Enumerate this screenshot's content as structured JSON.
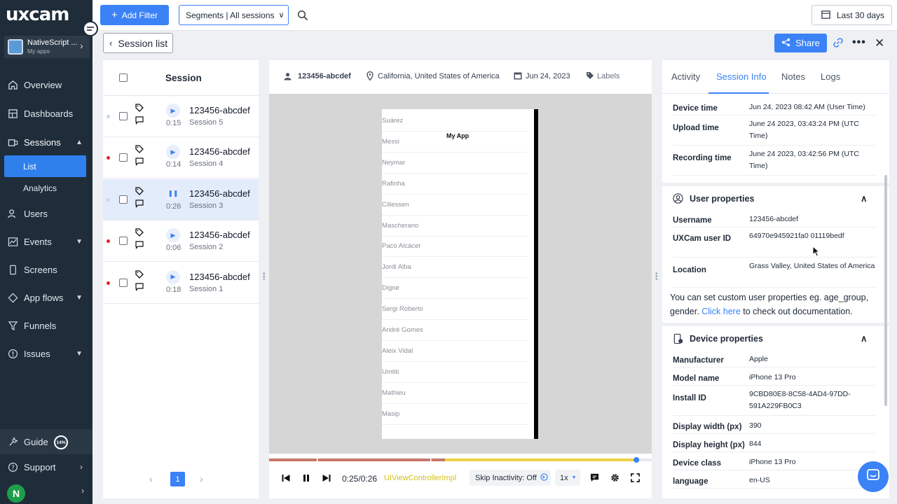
{
  "brand": {
    "logo": "uxcam"
  },
  "app_selector": {
    "name": "NativeScript ...",
    "subtitle": "My apps"
  },
  "nav": {
    "overview": "Overview",
    "dashboards": "Dashboards",
    "sessions": "Sessions",
    "list": "List",
    "analytics": "Analytics",
    "users": "Users",
    "events": "Events",
    "screens": "Screens",
    "app_flows": "App flows",
    "funnels": "Funnels",
    "issues": "Issues",
    "guide": "Guide",
    "guide_progress": "14%",
    "support": "Support",
    "avatar_initial": "N"
  },
  "topbar": {
    "add_filter": "Add Filter",
    "segments": "Segments | All sessions",
    "date_range": "Last 30 days"
  },
  "header": {
    "back_label": "Session list",
    "share_label": "Share"
  },
  "session_list": {
    "column_title": "Session",
    "rows": [
      {
        "id": "123456-abcdef",
        "session": "Session 5",
        "duration": "0:15",
        "dot": "#cbd5e1",
        "state": "play"
      },
      {
        "id": "123456-abcdef",
        "session": "Session 4",
        "duration": "0:14",
        "dot": "#dc2626",
        "state": "play"
      },
      {
        "id": "123456-abcdef",
        "session": "Session 3",
        "duration": "0:26",
        "dot": "#cbd5e1",
        "state": "pause"
      },
      {
        "id": "123456-abcdef",
        "session": "Session 2",
        "duration": "0:06",
        "dot": "#dc2626",
        "state": "play"
      },
      {
        "id": "123456-abcdef",
        "session": "Session 1",
        "duration": "0:18",
        "dot": "#dc2626",
        "state": "play"
      }
    ],
    "page": "1"
  },
  "player": {
    "user_id": "123456-abcdef",
    "location": "California, United States of America",
    "date": "Jun 24, 2023",
    "labels": "Labels",
    "app_title": "My App",
    "players": [
      "Suárez",
      "Messi",
      "Neymar",
      "Rafinha",
      "Cillessen",
      "Mascherano",
      "Paco Alcácer",
      "Jordi Alba",
      "Digne",
      "Sergi Roberto",
      "André Gomes",
      "Aleix Vidal",
      "Umtiti",
      "Mathieu",
      "Masip"
    ],
    "time": "0:25/0:26",
    "screen_name": "UIViewControllerImpl",
    "skip_inactivity": "Skip Inactivity: Off",
    "speed": "1x",
    "progress": 0.96
  },
  "info": {
    "tabs": [
      "Activity",
      "Session Info",
      "Notes",
      "Logs"
    ],
    "session_rows": [
      {
        "k": "Device time",
        "v": "Jun 24, 2023 08:42 AM (User Time)"
      },
      {
        "k": "Upload time",
        "v": "June 24 2023, 03:43:24 PM (UTC Time)"
      },
      {
        "k": "Recording time",
        "v": "June 24 2023, 03:42:56 PM (UTC Time)"
      }
    ],
    "user_props_title": "User properties",
    "user_rows": [
      {
        "k": "Username",
        "v": "123456-abcdef"
      },
      {
        "k": "UXCam user ID",
        "v": "64970e945921fa0 01119bedf"
      },
      {
        "k": "Location",
        "v": "Grass Valley, United States of America"
      }
    ],
    "custom_note_pre": "You can set custom user properties eg. age_group, gender.",
    "custom_note_link": "Click here",
    "custom_note_post": "to check out documentation.",
    "device_props_title": "Device properties",
    "device_rows": [
      {
        "k": "Manufacturer",
        "v": "Apple"
      },
      {
        "k": "Model name",
        "v": "iPhone 13 Pro"
      },
      {
        "k": "Install ID",
        "v": "9CBD80E8-8C58-4AD4-97DD-591A229FB0C3"
      },
      {
        "k": "Display width (px)",
        "v": "390"
      },
      {
        "k": "Display height (px)",
        "v": "844"
      },
      {
        "k": "Device class",
        "v": "iPhone 13 Pro"
      },
      {
        "k": "language",
        "v": "en-US"
      }
    ]
  }
}
